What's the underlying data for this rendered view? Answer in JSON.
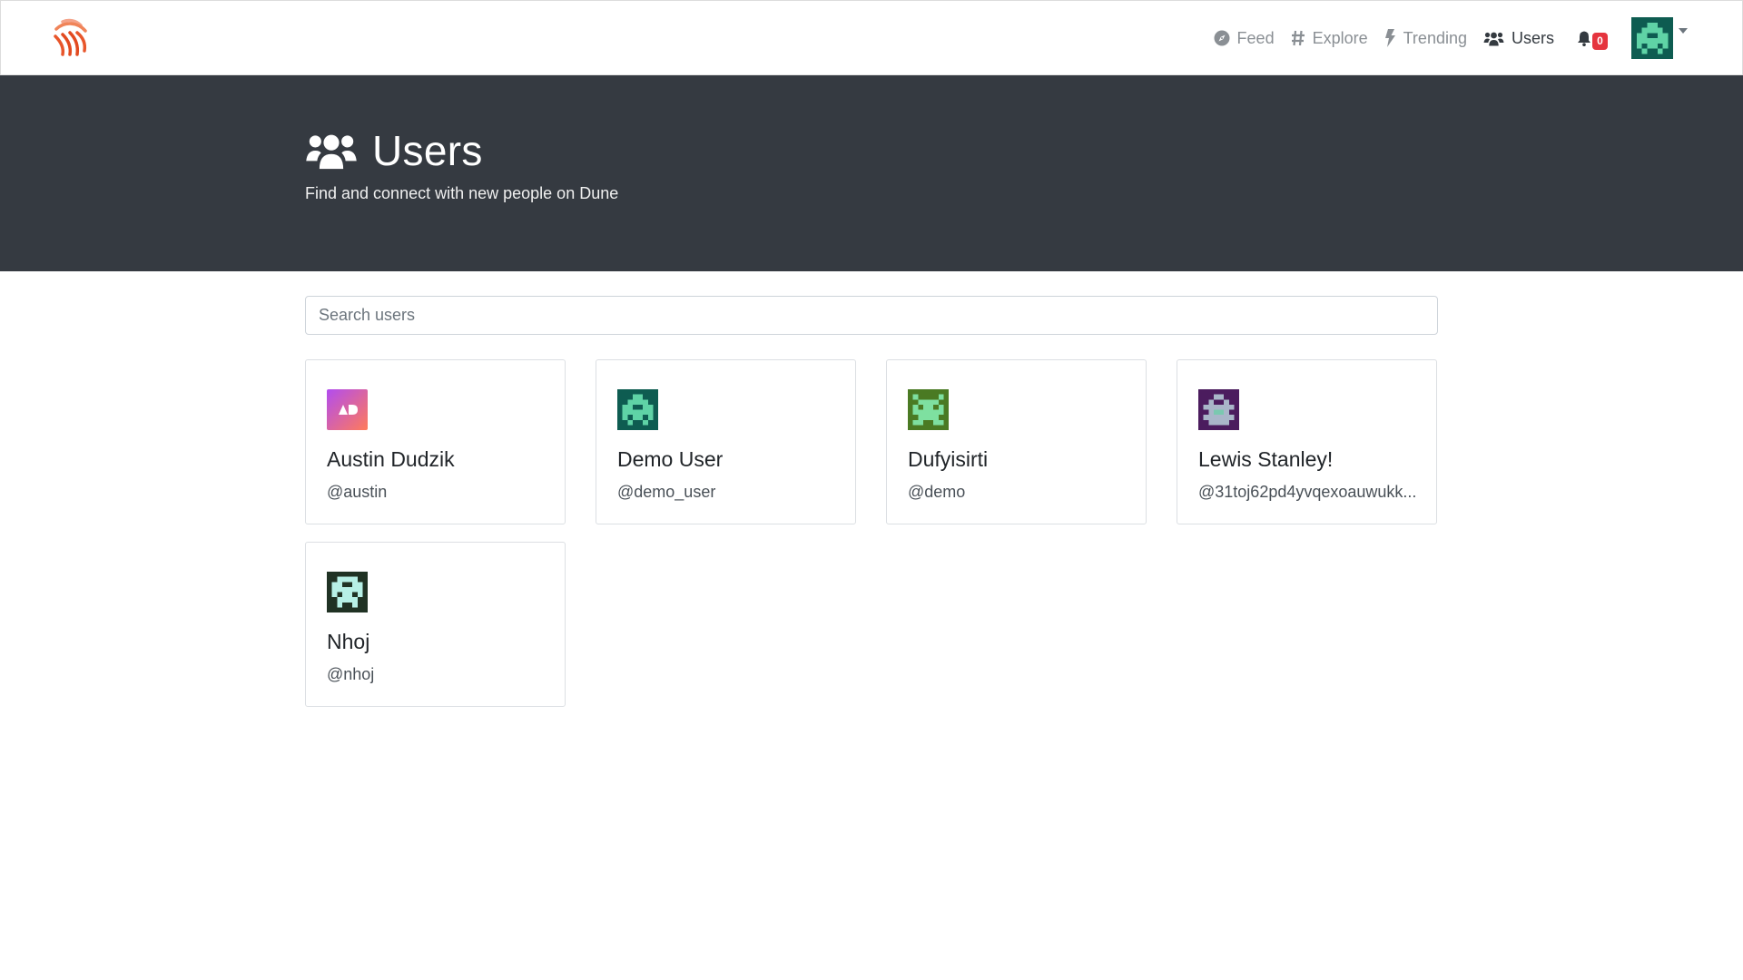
{
  "nav": {
    "logo": "dune-logo",
    "links": [
      {
        "label": "Feed",
        "icon": "compass-icon"
      },
      {
        "label": "Explore",
        "icon": "hashtag-icon"
      },
      {
        "label": "Trending",
        "icon": "bolt-icon"
      },
      {
        "label": "Users",
        "icon": "users-icon",
        "active": true
      }
    ],
    "notifications_count": "0",
    "accent": "#e5343e"
  },
  "hero": {
    "title": "Users",
    "subtitle": "Find and connect with new people on Dune",
    "background": "#353a41"
  },
  "search": {
    "placeholder": "Search users"
  },
  "users": [
    {
      "name": "Austin Dudzik",
      "handle": "@austin"
    },
    {
      "name": "Demo User",
      "handle": "@demo_user"
    },
    {
      "name": "Dufyisirti",
      "handle": "@demo"
    },
    {
      "name": "Lewis Stanley!",
      "handle": "@31toj62pd4yvqexoauwukk..."
    },
    {
      "name": "Nhoj",
      "handle": "@nhoj"
    }
  ]
}
